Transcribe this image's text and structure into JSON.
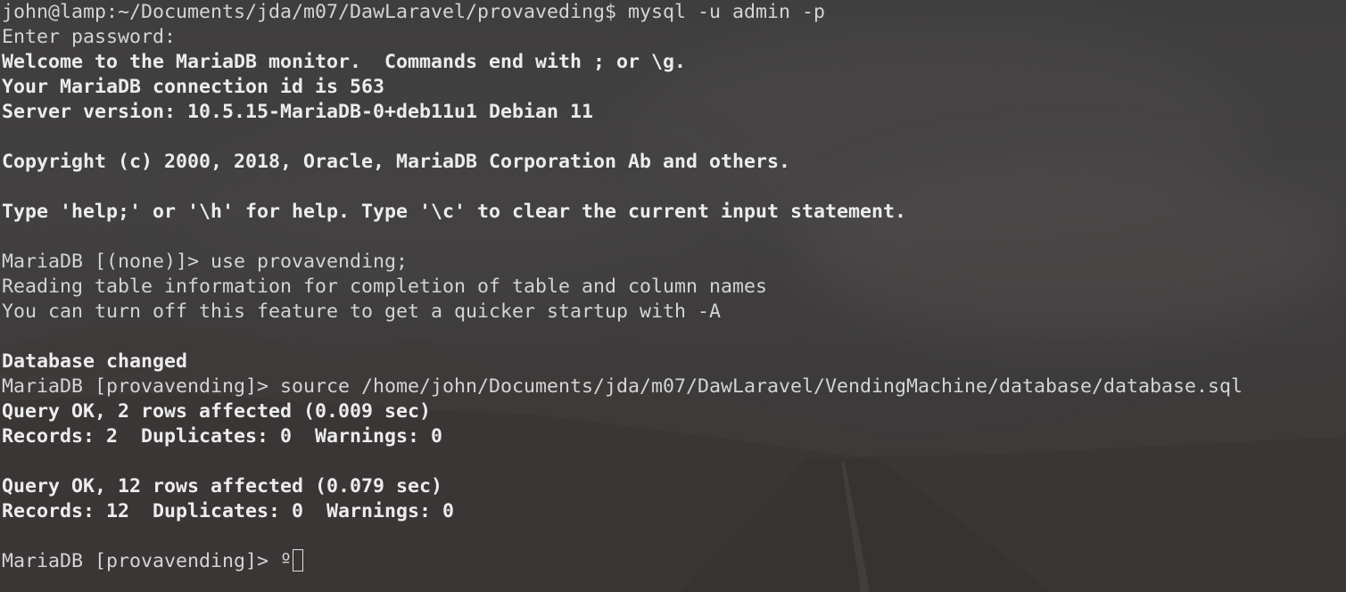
{
  "terminal": {
    "lines": [
      {
        "text": "john@lamp:~/Documents/jda/m07/DawLaravel/provaveding$ mysql -u admin -p",
        "bold": false
      },
      {
        "text": "Enter password:",
        "bold": false
      },
      {
        "text": "Welcome to the MariaDB monitor.  Commands end with ; or \\g.",
        "bold": true
      },
      {
        "text": "Your MariaDB connection id is 563",
        "bold": true
      },
      {
        "text": "Server version: 10.5.15-MariaDB-0+deb11u1 Debian 11",
        "bold": true
      },
      {
        "text": "",
        "bold": false
      },
      {
        "text": "Copyright (c) 2000, 2018, Oracle, MariaDB Corporation Ab and others.",
        "bold": true
      },
      {
        "text": "",
        "bold": false
      },
      {
        "text": "Type 'help;' or '\\h' for help. Type '\\c' to clear the current input statement.",
        "bold": true
      },
      {
        "text": "",
        "bold": false
      },
      {
        "text": "MariaDB [(none)]> use provavending;",
        "bold": false
      },
      {
        "text": "Reading table information for completion of table and column names",
        "bold": false
      },
      {
        "text": "You can turn off this feature to get a quicker startup with -A",
        "bold": false
      },
      {
        "text": "",
        "bold": false
      },
      {
        "text": "Database changed",
        "bold": true
      },
      {
        "text": "MariaDB [provavending]> source /home/john/Documents/jda/m07/DawLaravel/VendingMachine/database/database.sql",
        "bold": false
      },
      {
        "text": "Query OK, 2 rows affected (0.009 sec)",
        "bold": true
      },
      {
        "text": "Records: 2  Duplicates: 0  Warnings: 0",
        "bold": true
      },
      {
        "text": "",
        "bold": false
      },
      {
        "text": "Query OK, 12 rows affected (0.079 sec)",
        "bold": true
      },
      {
        "text": "Records: 12  Duplicates: 0  Warnings: 0",
        "bold": true
      },
      {
        "text": "",
        "bold": false
      }
    ],
    "prompt": "MariaDB [provavending]> ",
    "input": "º"
  },
  "colors": {
    "text": "#d4d4d4",
    "bold_text": "#ececec",
    "background": "#3b3a3b"
  }
}
